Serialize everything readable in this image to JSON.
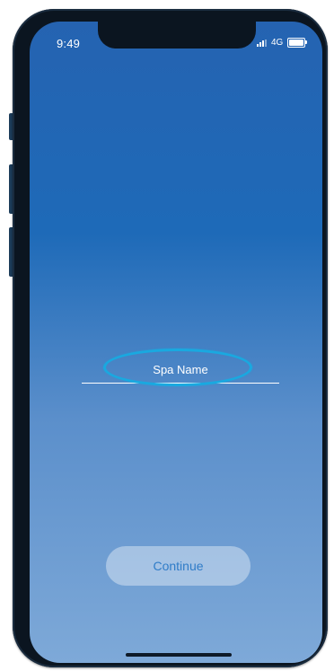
{
  "status_bar": {
    "time": "9:49",
    "network": "4G",
    "signal_bars_active": 3,
    "battery_level": 1.0
  },
  "form": {
    "spa_name_placeholder": "Spa Name",
    "spa_name_value": ""
  },
  "actions": {
    "continue_label": "Continue"
  },
  "colors": {
    "gradient_top": "#2563b1",
    "gradient_bottom": "#7ea9d8",
    "highlight_ring": "#19a9e0",
    "continue_text": "#2f7cc8"
  },
  "icons": {
    "signal": "cellular-signal-icon",
    "battery": "battery-icon"
  }
}
